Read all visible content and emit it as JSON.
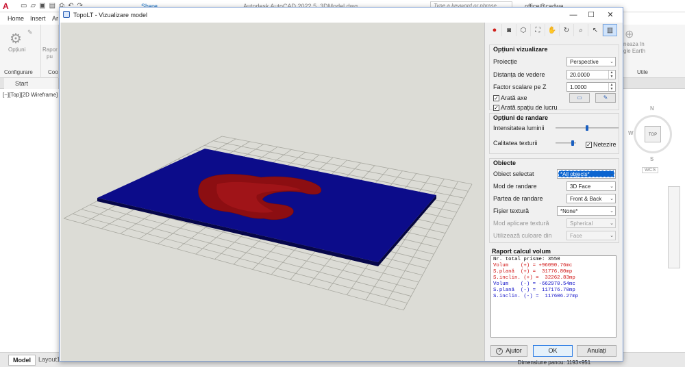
{
  "acad": {
    "logo": "A",
    "share_label": "Share",
    "title": "Autodesk AutoCAD 2022   5_3DModel.dwg",
    "search_placeholder": "Type a keyword or phrase",
    "user": "office@cadwa...",
    "tabs": [
      "Home",
      "Insert",
      "Ar"
    ],
    "ribbon": {
      "options_label": "Opțiuni",
      "report_label": "Rapor",
      "report_label2": "pu",
      "configure_group": "Configurare",
      "coo_group": "Coo",
      "right_text1": "neaza în",
      "right_text2": "gle Earth",
      "utile_group": "Utile"
    },
    "start_tab": "Start",
    "view_label": "[−][Top][2D Wireframe]",
    "viewcube": {
      "n": "N",
      "w": "W",
      "s": "S",
      "top": "TOP",
      "wcs": "WCS"
    },
    "status": {
      "model": "Model",
      "layout": "Layout1"
    }
  },
  "dialog": {
    "title": "TopoLT - Vizualizare model",
    "window_buttons": {
      "minimize": "—",
      "maximize": "☐",
      "close": "✕"
    },
    "toolbar_icons": [
      "record-icon",
      "camera-icon",
      "cube-icon",
      "fit-icon",
      "pan-icon",
      "orbit-icon",
      "zoom-icon",
      "select-icon",
      "panel-icon"
    ],
    "sections": {
      "view": {
        "title": "Opțiuni vizualizare",
        "projection_label": "Proiecție",
        "projection_value": "Perspective",
        "distance_label": "Distanța de vedere",
        "distance_value": "20.0000",
        "zscale_label": "Factor scalare pe Z",
        "zscale_value": "1.0000",
        "show_axes": "Arată axe",
        "show_workspace": "Arată spațiu de lucru"
      },
      "render": {
        "title": "Opțiuni de randare",
        "light_label": "Intensitatea luminii",
        "light_level": 0.5,
        "texture_label": "Calitatea texturii",
        "texture_level": 0.9,
        "smoothing_label": "Netezire"
      },
      "objects": {
        "title": "Obiecte",
        "selected_label": "Obiect selectat",
        "selected_value": "*All objects*",
        "mode_label": "Mod de randare",
        "mode_value": "3D Face",
        "side_label": "Partea de randare",
        "side_value": "Front & Back",
        "texture_file_label": "Fișier textură",
        "texture_file_value": "*None*",
        "apply_label": "Mod aplicare textură",
        "apply_value": "Spherical",
        "color_label": "Utilizează culoare din",
        "color_value": "Face"
      }
    },
    "report": {
      "title": "Raport calcul volum",
      "lines": [
        {
          "text": "Nr. total prisme: 3550",
          "color": "#000000"
        },
        {
          "text": "Volum    (+) = +96090.76mc",
          "color": "#d01010"
        },
        {
          "text": "S.plană  (+) =  31776.80mp",
          "color": "#d01010"
        },
        {
          "text": "S.inclin. (+) =  32262.83mp",
          "color": "#d01010"
        },
        {
          "text": "Volum    (-) = -662970.54mc",
          "color": "#1010c8"
        },
        {
          "text": "S.plană  (-) =  117176.70mp",
          "color": "#1010c8"
        },
        {
          "text": "S.inclin. (-) =  117606.27mp",
          "color": "#1010c8"
        }
      ]
    },
    "buttons": {
      "help": "Ajutor",
      "ok": "OK",
      "cancel": "Anulați"
    },
    "panel_dims": "Dimensiune panou:  1193×951"
  }
}
